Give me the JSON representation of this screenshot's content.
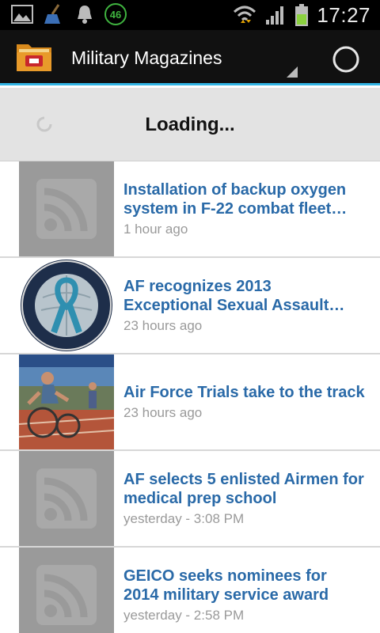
{
  "status_bar": {
    "icons": [
      "image-notification-icon",
      "broom-icon",
      "bell-icon",
      "battery-level-badge-icon",
      "wifi-icon",
      "signal-icon",
      "battery-icon"
    ],
    "badge_value": "46",
    "time": "17:27"
  },
  "action_bar": {
    "title": "Military Magazines",
    "app_icon": "folder-icon",
    "refresh_icon": "refresh-circle-icon",
    "accent_color": "#33b5e5"
  },
  "loading": {
    "text": "Loading..."
  },
  "articles": [
    {
      "title": "Installation of backup oxygen\nsystem in F-22 combat fleet…",
      "meta": "1 hour ago",
      "thumb": "rss-placeholder"
    },
    {
      "title": "AF recognizes 2013\nExceptional Sexual Assault…",
      "meta": "23 hours ago",
      "thumb": "sarc-seal"
    },
    {
      "title": "Air Force Trials take to the track",
      "meta": "23 hours ago",
      "thumb": "wheelchair-race-photo"
    },
    {
      "title": "AF selects 5 enlisted Airmen for\nmedical prep school",
      "meta": "yesterday - 3:08 PM",
      "thumb": "rss-placeholder"
    },
    {
      "title": "GEICO seeks nominees for\n2014 military service award",
      "meta": "yesterday - 2:58 PM",
      "thumb": "rss-placeholder"
    }
  ],
  "colors": {
    "title_blue": "#2a6aa8",
    "meta_gray": "#9a9a9a",
    "loading_bg": "#e3e3e3"
  }
}
